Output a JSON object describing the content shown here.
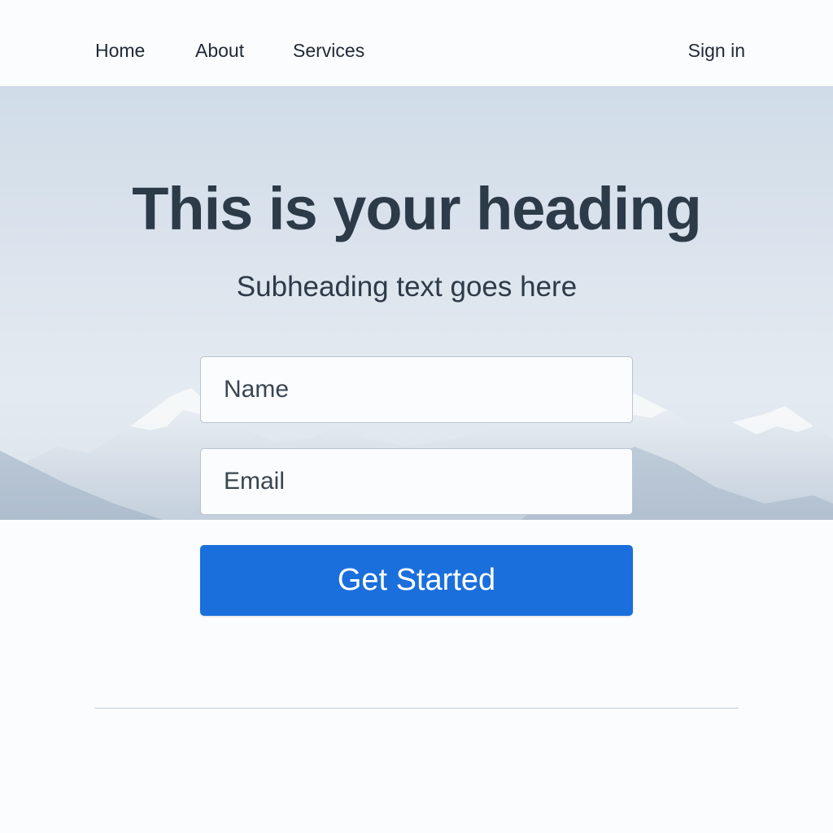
{
  "nav": {
    "home": "Home",
    "about": "About",
    "services": "Services",
    "sign_in": "Sign in"
  },
  "hero": {
    "heading": "This is your heading",
    "subheading": "Subheading text goes here",
    "background": "snowy-mountains-image"
  },
  "form": {
    "name_placeholder": "Name",
    "name_value": "",
    "email_placeholder": "Email",
    "email_value": "",
    "submit_label": "Get Started"
  },
  "colors": {
    "accent": "#1a6fdc",
    "text": "#2d3a48",
    "background": "#fbfcfd"
  }
}
